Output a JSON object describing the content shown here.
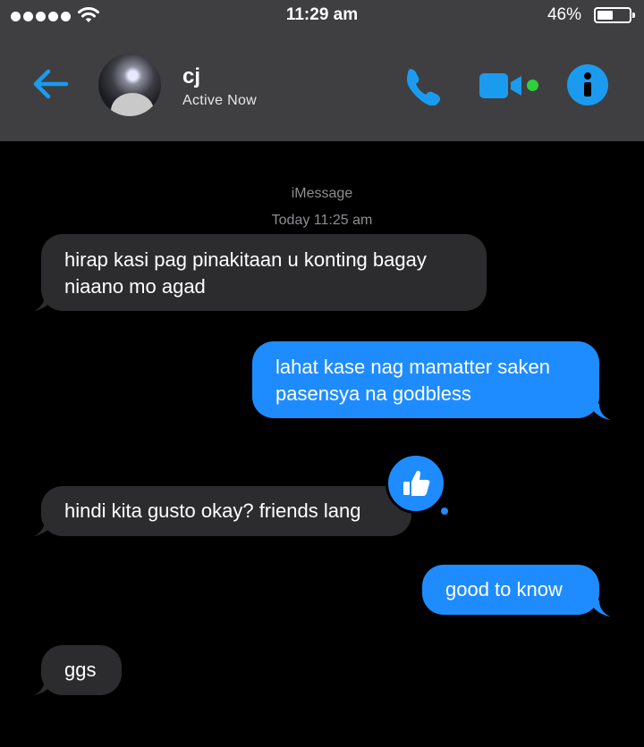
{
  "status_bar": {
    "time": "11:29 am",
    "battery_percent": "46%",
    "signal_bars": 5,
    "battery_level": 0.46
  },
  "header": {
    "contact_name": "cj",
    "presence": "Active Now",
    "icons": [
      "back-arrow-icon",
      "phone-icon",
      "video-camera-icon",
      "info-icon"
    ],
    "accent_color": "#1a9bf0",
    "online_color": "#2ed03b"
  },
  "conversation": {
    "service_label": "iMessage",
    "timestamp": "Today 11:25 am",
    "messages": [
      {
        "direction": "incoming",
        "text_line1": "hirap kasi pag pinakitaan u konting bagay",
        "text_line2": "niaano mo agad"
      },
      {
        "direction": "outgoing",
        "text_line1": "lahat kase nag mamatter saken",
        "text_line2": "pasensya na godbless"
      },
      {
        "direction": "incoming",
        "text": "hindi kita gusto okay? friends lang",
        "reaction": "thumbs-up-icon"
      },
      {
        "direction": "outgoing",
        "text": "good to know"
      },
      {
        "direction": "incoming",
        "text": "ggs"
      }
    ],
    "incoming_color": "#2c2c2e",
    "outgoing_color": "#1e8cff"
  }
}
